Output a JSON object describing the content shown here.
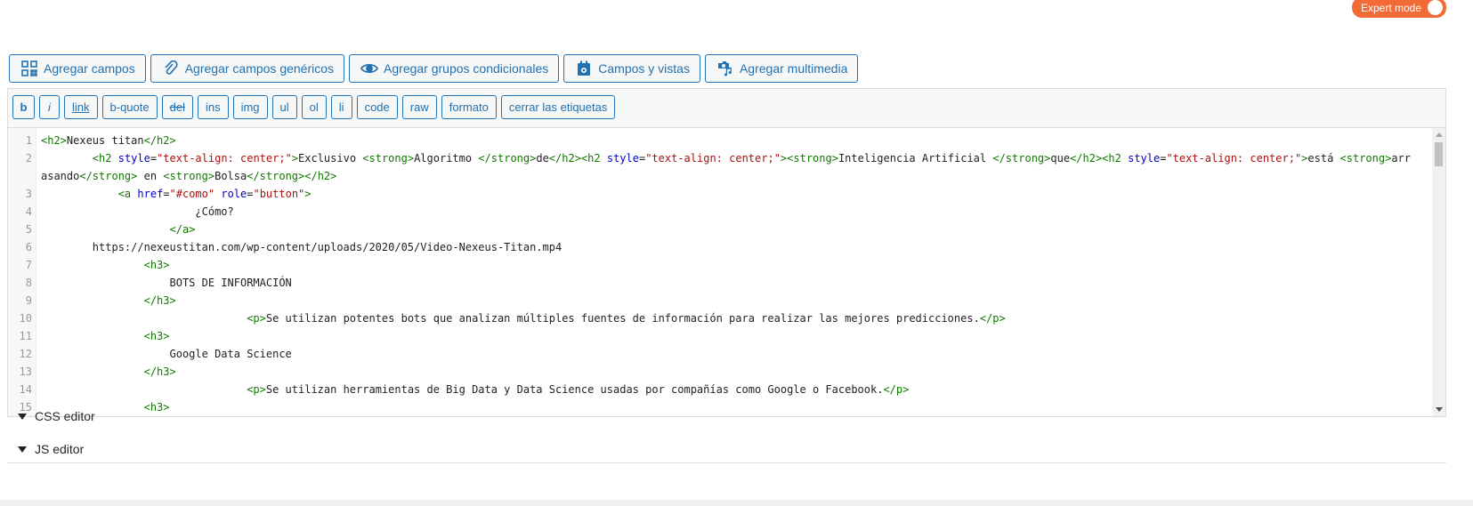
{
  "expert_mode": {
    "label": "Expert mode",
    "enabled": true,
    "color": "#f26a35"
  },
  "toolbar": {
    "buttons": [
      {
        "label": "Agregar campos",
        "icon": "fields-grid-icon"
      },
      {
        "label": "Agregar campos genéricos",
        "icon": "paperclip-icon"
      },
      {
        "label": "Agregar grupos condicionales",
        "icon": "eye-icon"
      },
      {
        "label": "Campos y vistas",
        "icon": "calendar-icon"
      },
      {
        "label": "Agregar multimedia",
        "icon": "media-icon"
      }
    ]
  },
  "quicktags": [
    "b",
    "i",
    "link",
    "b-quote",
    "del",
    "ins",
    "img",
    "ul",
    "ol",
    "li",
    "code",
    "raw",
    "formato",
    "cerrar las etiquetas"
  ],
  "code_lines": [
    {
      "n": "1",
      "html": "<span class=\"tag\">&lt;h2&gt;</span>Nexeus titan<span class=\"tag\">&lt;/h2&gt;</span>"
    },
    {
      "n": "2",
      "wrap": true,
      "html": "        <span class=\"tag\">&lt;h2</span> <span class=\"attr\">style</span>=<span class=\"str\">\"text-align: center;\"</span><span class=\"tag\">&gt;</span>Exclusivo <span class=\"tag\">&lt;strong&gt;</span>Algoritmo <span class=\"tag\">&lt;/strong&gt;</span>de<span class=\"tag\">&lt;/h2&gt;&lt;h2</span> <span class=\"attr\">style</span>=<span class=\"str\">\"text-align: center;\"</span><span class=\"tag\">&gt;&lt;strong&gt;</span>Inteligencia Artificial <span class=\"tag\">&lt;/strong&gt;</span>que<span class=\"tag\">&lt;/h2&gt;&lt;h2</span> <span class=\"attr\">style</span>=<span class=\"str\">\"text-align: center;\"</span><span class=\"tag\">&gt;</span>está <span class=\"tag\">&lt;strong&gt;</span>arrasando<span class=\"tag\">&lt;/strong&gt;</span> en <span class=\"tag\">&lt;strong&gt;</span>Bolsa<span class=\"tag\">&lt;/strong&gt;&lt;/h2&gt;</span>"
    },
    {
      "n": "3",
      "html": "            <span class=\"tag\">&lt;a</span> <span class=\"attr\">href</span>=<span class=\"str\">\"#como\"</span> <span class=\"attr\">role</span>=<span class=\"str\">\"button\"</span><span class=\"tag\">&gt;</span>"
    },
    {
      "n": "4",
      "html": "                        ¿Cómo?"
    },
    {
      "n": "5",
      "html": "                    <span class=\"tag\">&lt;/a&gt;</span>"
    },
    {
      "n": "6",
      "html": "        https://nexeustitan.com/wp-content/uploads/2020/05/Video-Nexeus-Titan.mp4"
    },
    {
      "n": "7",
      "html": "                <span class=\"tag\">&lt;h3&gt;</span>"
    },
    {
      "n": "8",
      "html": "                    BOTS DE INFORMACIÓN"
    },
    {
      "n": "9",
      "html": "                <span class=\"tag\">&lt;/h3&gt;</span>"
    },
    {
      "n": "10",
      "html": "                                <span class=\"tag\">&lt;p&gt;</span>Se utilizan potentes bots que analizan múltiples fuentes de información para realizar las mejores predicciones.<span class=\"tag\">&lt;/p&gt;</span>"
    },
    {
      "n": "11",
      "html": "                <span class=\"tag\">&lt;h3&gt;</span>"
    },
    {
      "n": "12",
      "html": "                    Google Data Science"
    },
    {
      "n": "13",
      "html": "                <span class=\"tag\">&lt;/h3&gt;</span>"
    },
    {
      "n": "14",
      "html": "                                <span class=\"tag\">&lt;p&gt;</span>Se utilizan herramientas de Big Data y Data Science usadas por compañías como Google o Facebook.<span class=\"tag\">&lt;/p&gt;</span>"
    },
    {
      "n": "15",
      "html": "                <span class=\"tag\">&lt;h3&gt;</span>"
    }
  ],
  "sections": {
    "css_editor": "CSS editor",
    "js_editor": "JS editor"
  },
  "colors": {
    "accent": "#2271b1",
    "tag": "#117700",
    "attr": "#0000cc",
    "string": "#aa1111"
  }
}
